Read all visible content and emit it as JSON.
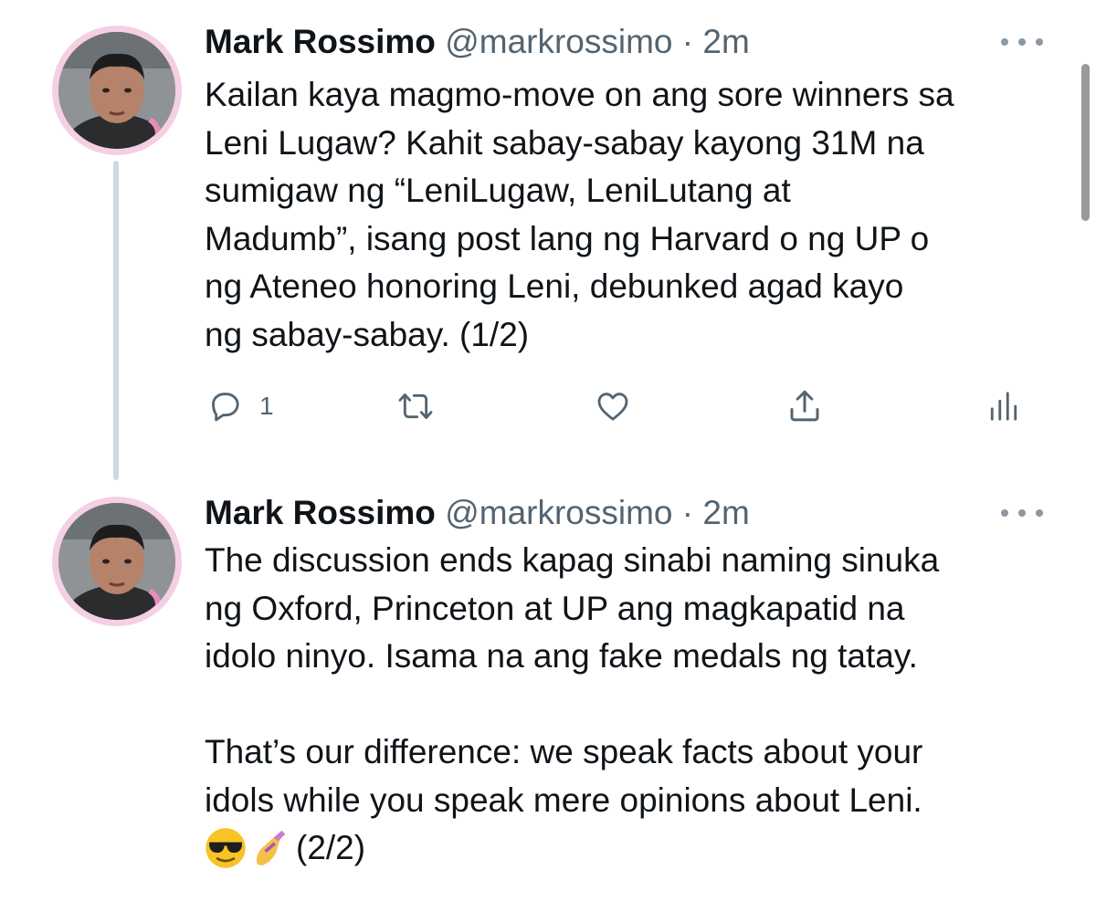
{
  "tweets": [
    {
      "name": "Mark Rossimo",
      "handle": "@markrossimo",
      "separator": "·",
      "time": "2m",
      "lines": [
        "Kailan kaya magmo-move on ang sore winners sa",
        "Leni Lugaw? Kahit sabay-sabay kayong 31M na",
        "sumigaw ng “LeniLugaw, LeniLutang at",
        "Madumb”, isang post lang ng Harvard o ng UP o",
        "ng Ateneo honoring Leni, debunked agad kayo",
        "ng sabay-sabay. (1/2)"
      ],
      "reply_count": "1"
    },
    {
      "name": "Mark Rossimo",
      "handle": "@markrossimo",
      "separator": "·",
      "time": "2m",
      "lines": [
        "The discussion ends kapag sinabi naming sinuka",
        "ng Oxford, Princeton at UP ang magkapatid na",
        "idolo ninyo. Isama na ang fake medals ng tatay.",
        "",
        "That’s our difference: we speak facts about your",
        "idols while you speak mere opinions about Leni."
      ],
      "last_line_suffix": "(2/2)",
      "emojis": [
        "smiling-face-with-sunglasses",
        "nail-polish"
      ]
    }
  ],
  "icons": [
    "reply-icon",
    "retweet-icon",
    "like-icon",
    "share-icon",
    "analytics-icon",
    "more-icon"
  ],
  "colors": {
    "text": "#0f1419",
    "secondary": "#536471",
    "thread_line": "#cfd9de",
    "avatar_ring": "#f5cfe3"
  }
}
